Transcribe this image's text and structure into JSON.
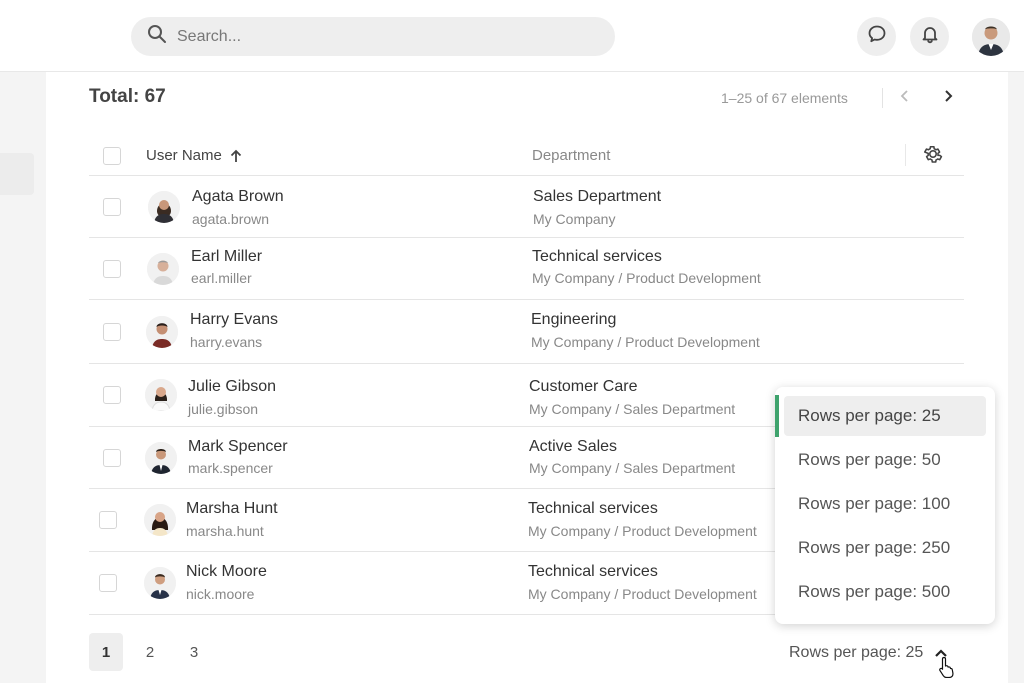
{
  "search": {
    "placeholder": "Search..."
  },
  "header": {
    "chat_icon": "chat-bubble-icon",
    "bell_icon": "bell-icon"
  },
  "table": {
    "total_label": "Total: 67",
    "range_label": "1–25 of 67 elements",
    "columns": {
      "user": "User Name",
      "department": "Department"
    },
    "rows": [
      {
        "name": "Agata Brown",
        "login": "agata.brown",
        "dept": "Sales Department",
        "org": "My Company"
      },
      {
        "name": "Earl Miller",
        "login": "earl.miller",
        "dept": "Technical services",
        "org": "My Company / Product Development"
      },
      {
        "name": "Harry Evans",
        "login": "harry.evans",
        "dept": "Engineering",
        "org": "My Company / Product Development"
      },
      {
        "name": "Julie Gibson",
        "login": "julie.gibson",
        "dept": "Customer Care",
        "org": "My Company / Sales Department"
      },
      {
        "name": "Mark Spencer",
        "login": "mark.spencer",
        "dept": "Active Sales",
        "org": "My Company / Sales Department"
      },
      {
        "name": "Marsha Hunt",
        "login": "marsha.hunt",
        "dept": "Technical services",
        "org": "My Company / Product Development"
      },
      {
        "name": "Nick Moore",
        "login": "nick.moore",
        "dept": "Technical services",
        "org": "My Company / Product Development"
      }
    ]
  },
  "pagination": {
    "pages": [
      "1",
      "2",
      "3"
    ],
    "rows_per_page_label": "Rows per page: 25"
  },
  "dropdown": {
    "options": [
      "Rows per page: 25",
      "Rows per page: 50",
      "Rows per page: 100",
      "Rows per page: 250",
      "Rows per page: 500"
    ],
    "selected": "Rows per page: 25"
  },
  "colors": {
    "accent": "#3fa36d"
  }
}
